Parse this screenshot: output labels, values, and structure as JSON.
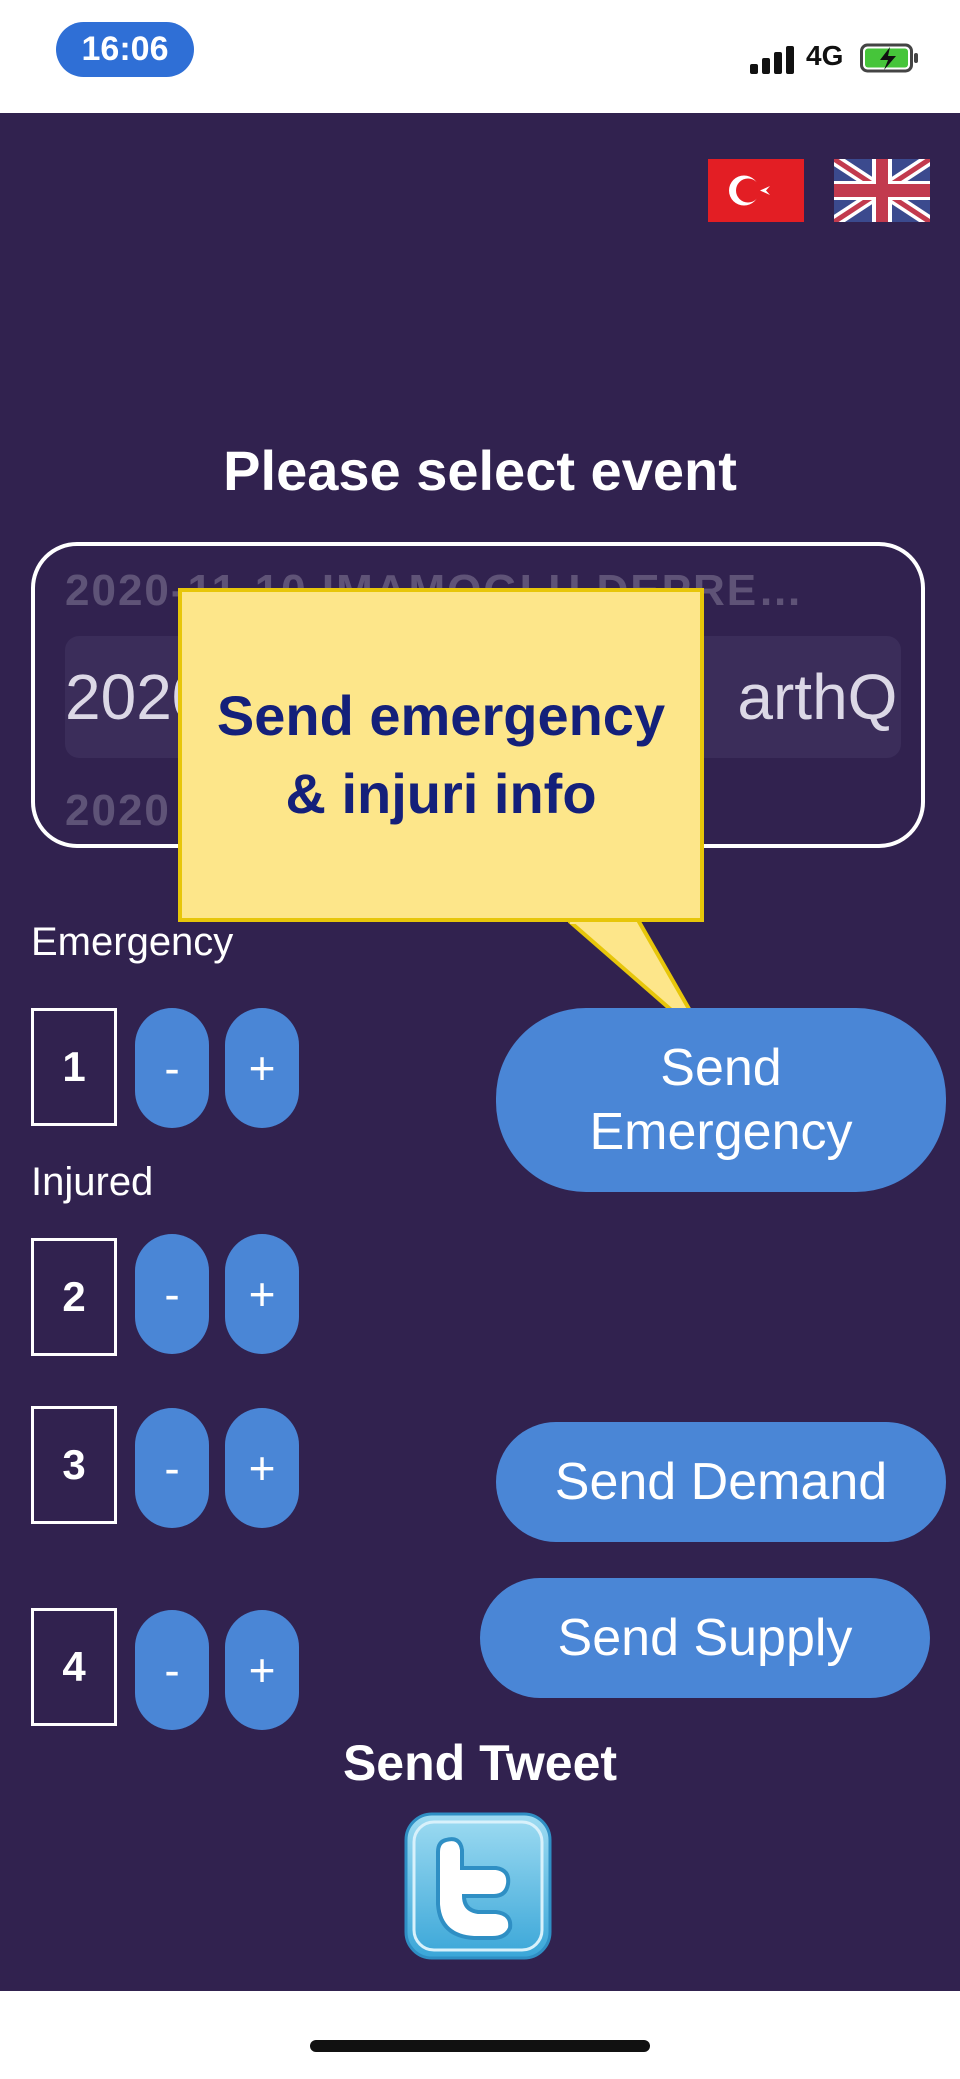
{
  "status_bar": {
    "time": "16:06",
    "network": "4G"
  },
  "languages": {
    "turkish": "Turkish flag",
    "english": "UK flag"
  },
  "event_picker": {
    "title": "Please select event",
    "above_option": "2020-11-10 IMAMOGLU DEPRE…",
    "selected_option_left": "2020",
    "selected_option_right": "arthQ…",
    "below_option": "2020 … EarthQ…"
  },
  "tooltip": {
    "text": "Send emergency & injuri info"
  },
  "counters": {
    "emergency_label": "Emergency",
    "injured_label": "Injured",
    "rows": [
      {
        "value": "1",
        "minus": "-",
        "plus": "+"
      },
      {
        "value": "2",
        "minus": "-",
        "plus": "+"
      },
      {
        "value": "3",
        "minus": "-",
        "plus": "+"
      },
      {
        "value": "4",
        "minus": "-",
        "plus": "+"
      }
    ]
  },
  "actions": {
    "send_emergency": "Send Emergency",
    "send_demand": "Send Demand",
    "send_supply": "Send Supply",
    "send_tweet": "Send Tweet"
  },
  "colors": {
    "background": "#31224f",
    "button": "#4a86d6",
    "tooltip_bg": "#fde68a",
    "tooltip_text": "#14207a",
    "time_pill": "#2f6fd6"
  }
}
